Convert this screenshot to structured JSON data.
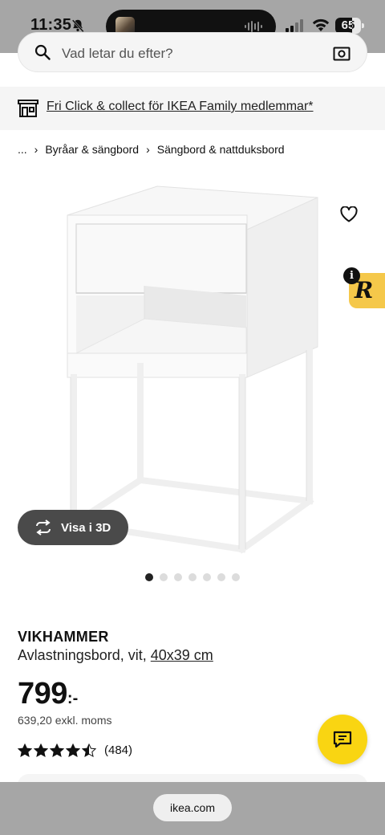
{
  "status_bar": {
    "time": "11:35",
    "battery_level": "65",
    "battery_fraction": 0.65
  },
  "search": {
    "placeholder": "Vad letar du efter?"
  },
  "promo": {
    "text": "Fri Click & collect för IKEA Family medlemmar*"
  },
  "breadcrumb": {
    "ellipsis": "...",
    "items": [
      "Byråar & sängbord",
      "Sängbord & nattduksbord"
    ]
  },
  "gallery": {
    "view_3d_label": "Visa i 3D",
    "image_count": 7,
    "active_index": 0
  },
  "extension": {
    "info_label": "i",
    "logo_letter": "R"
  },
  "product": {
    "name": "VIKHAMMER",
    "description": "Avlastningsbord, vit, ",
    "size": "40x39 cm",
    "price": "799",
    "price_suffix": ":-",
    "price_ex_vat": "639,20 exkl. moms",
    "rating": 4.5,
    "rating_max": 5,
    "review_count": "(484)"
  },
  "browser": {
    "url": "ikea.com"
  },
  "colors": {
    "ikea_yellow": "#f9d512",
    "status_bar_gray": "#a6a6a6"
  },
  "icons": [
    "bell-slash-icon",
    "signal-icon",
    "wifi-icon",
    "battery-icon",
    "search-icon",
    "camera-icon",
    "store-icon",
    "heart-icon",
    "rotate-3d-icon",
    "star-icon",
    "chat-icon"
  ]
}
